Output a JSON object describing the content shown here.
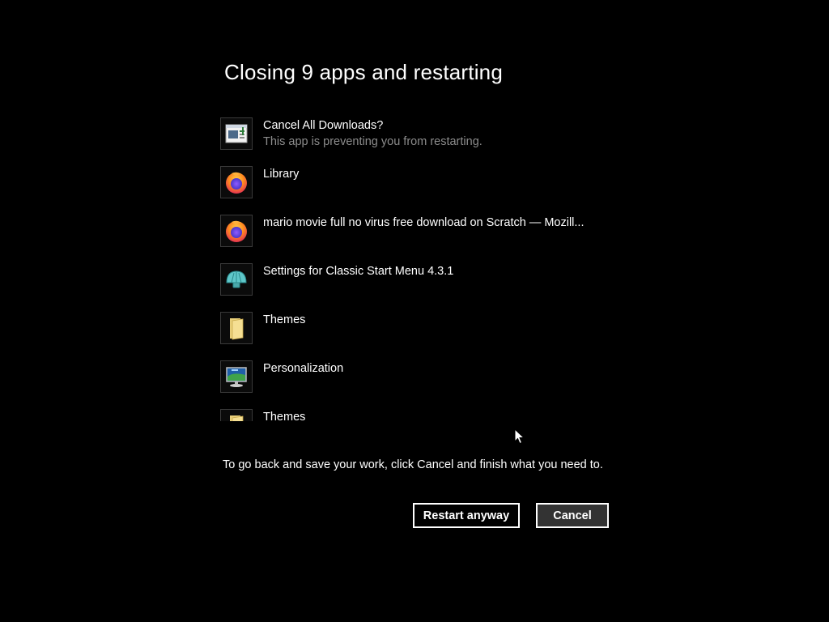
{
  "dialog": {
    "title": "Closing 9 apps and restarting",
    "message": "To go back and save your work, click Cancel and finish what you need to.",
    "restart_label": "Restart anyway",
    "cancel_label": "Cancel"
  },
  "apps": [
    {
      "name": "Cancel All Downloads?",
      "subtitle": "This app is preventing you from restarting.",
      "icon": "downloads-window-icon"
    },
    {
      "name": "Library",
      "subtitle": "",
      "icon": "firefox-icon"
    },
    {
      "name": "mario movie full no virus free download on Scratch — Mozill...",
      "subtitle": "",
      "icon": "firefox-icon"
    },
    {
      "name": "Settings for Classic Start Menu 4.3.1",
      "subtitle": "",
      "icon": "classic-shell-icon"
    },
    {
      "name": "Themes",
      "subtitle": "",
      "icon": "folder-icon"
    },
    {
      "name": "Personalization",
      "subtitle": "",
      "icon": "monitor-icon"
    },
    {
      "name": "Themes",
      "subtitle": "",
      "icon": "folder-icon"
    }
  ]
}
